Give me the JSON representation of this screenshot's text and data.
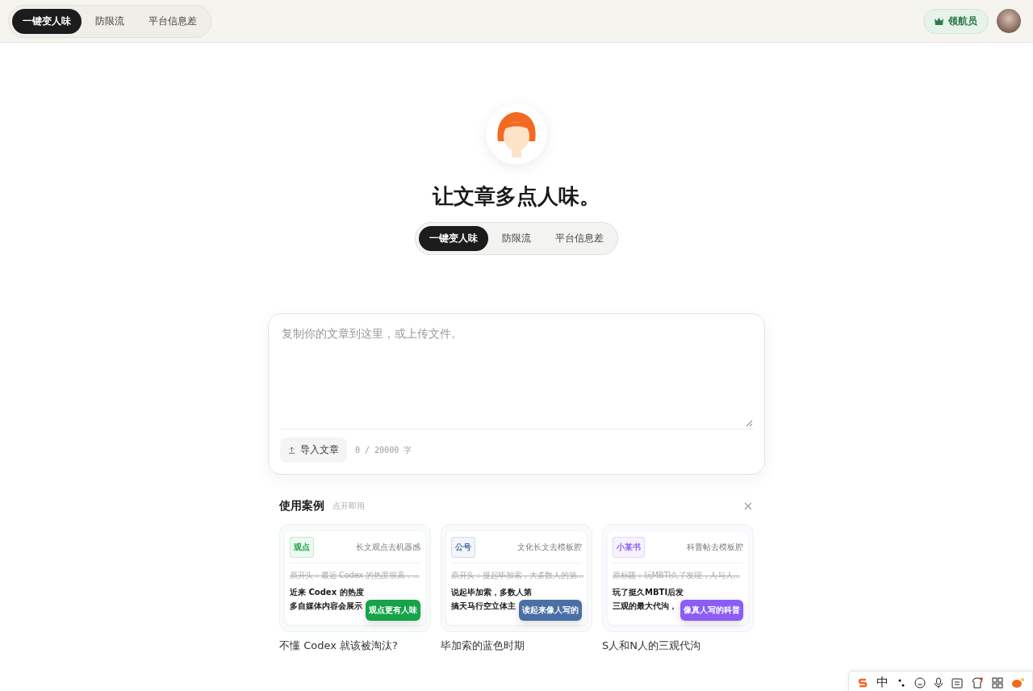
{
  "header": {
    "tabs": [
      {
        "label": "一键变人味",
        "selected": true
      },
      {
        "label": "防限流",
        "selected": false
      },
      {
        "label": "平台信息差",
        "selected": false
      }
    ],
    "member_badge": "领航员"
  },
  "hero": {
    "title": "让文章多点人味。",
    "tabs": [
      {
        "label": "一键变人味",
        "selected": true
      },
      {
        "label": "防限流",
        "selected": false
      },
      {
        "label": "平台信息差",
        "selected": false
      }
    ]
  },
  "editor": {
    "placeholder": "复制你的文章到这里，或上传文件。",
    "import_button": "导入文章",
    "counter": "0 / 20000 字"
  },
  "examples": {
    "title": "使用案例",
    "hint": "点开即用",
    "cards": [
      {
        "tag": "观点",
        "color": "#16a34a",
        "subtitle": "长文观点去机器感",
        "original": "原开头：最近 Codex 的热度很高，...",
        "rewrite_lines": [
          "近来 Codex 的热度",
          "多自媒体内容会展示"
        ],
        "badge": "观点更有人味",
        "caption": "不懂 Codex 就该被淘汰?"
      },
      {
        "tag": "公号",
        "color": "#4a6fa5",
        "subtitle": "文化长文去模板腔",
        "original": "原开头：提起毕加索，大多数人的第...",
        "rewrite_lines": [
          "说起毕加索，多数人第",
          "搞天马行空立体主"
        ],
        "badge": "读起来像人写的",
        "caption": "毕加索的蓝色时期"
      },
      {
        "tag": "小某书",
        "color": "#8b5cf6",
        "subtitle": "科普帖去模板腔",
        "original": "原标题：玩MBTI久了发现，人与人...",
        "rewrite_lines": [
          "玩了挺久MBTI后发",
          "三观的最大代沟，"
        ],
        "badge": "像真人写的科普",
        "caption": "S人和N人的三观代沟"
      }
    ]
  },
  "ime_toolbar": {
    "mode": "中"
  }
}
